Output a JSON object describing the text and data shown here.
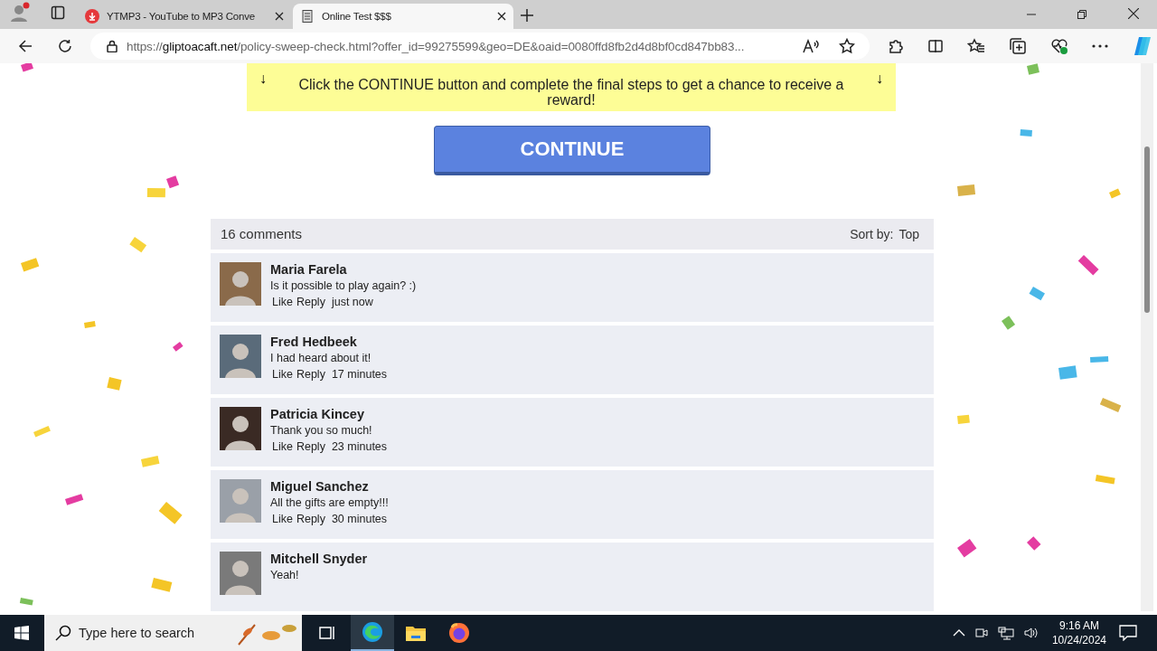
{
  "browser": {
    "tabs": [
      {
        "title": "YTMP3 - YouTube to MP3 Conve",
        "kind": "download",
        "selected": false
      },
      {
        "title": "Online Test $$$",
        "kind": "page",
        "selected": true
      }
    ],
    "address": {
      "scheme": "https://",
      "host": "gliptoacaft.net",
      "rest": "/policy-sweep-check.html?offer_id=99275599&geo=DE&oaid=0080ffd8fb2d4d8bf0cd847bb83..."
    }
  },
  "page": {
    "banner": {
      "arrow_left": "↓",
      "text": "Click the CONTINUE button and complete the final steps to get a chance to receive a reward!",
      "arrow_right": "↓"
    },
    "button": "CONTINUE",
    "comments_header": {
      "count": "16 comments",
      "sort_label": "Sort by:",
      "sort_value": "Top"
    },
    "comments": [
      {
        "name": "Maria Farela",
        "text": "Is it possible to play again? :)",
        "like": "Like",
        "reply": "Reply",
        "time": "just now"
      },
      {
        "name": "Fred Hedbeek",
        "text": "I had heard about it!",
        "like": "Like",
        "reply": "Reply",
        "time": "17 minutes"
      },
      {
        "name": "Patricia Kincey",
        "text": "Thank you so much!",
        "like": "Like",
        "reply": "Reply",
        "time": "23 minutes"
      },
      {
        "name": "Miguel Sanchez",
        "text": "All the gifts are empty!!!",
        "like": "Like",
        "reply": "Reply",
        "time": "30 minutes"
      },
      {
        "name": "Mitchell Snyder",
        "text": "Yeah!"
      }
    ]
  },
  "taskbar": {
    "search_placeholder": "Type here to search",
    "time": "9:16 AM",
    "date": "10/24/2024"
  }
}
